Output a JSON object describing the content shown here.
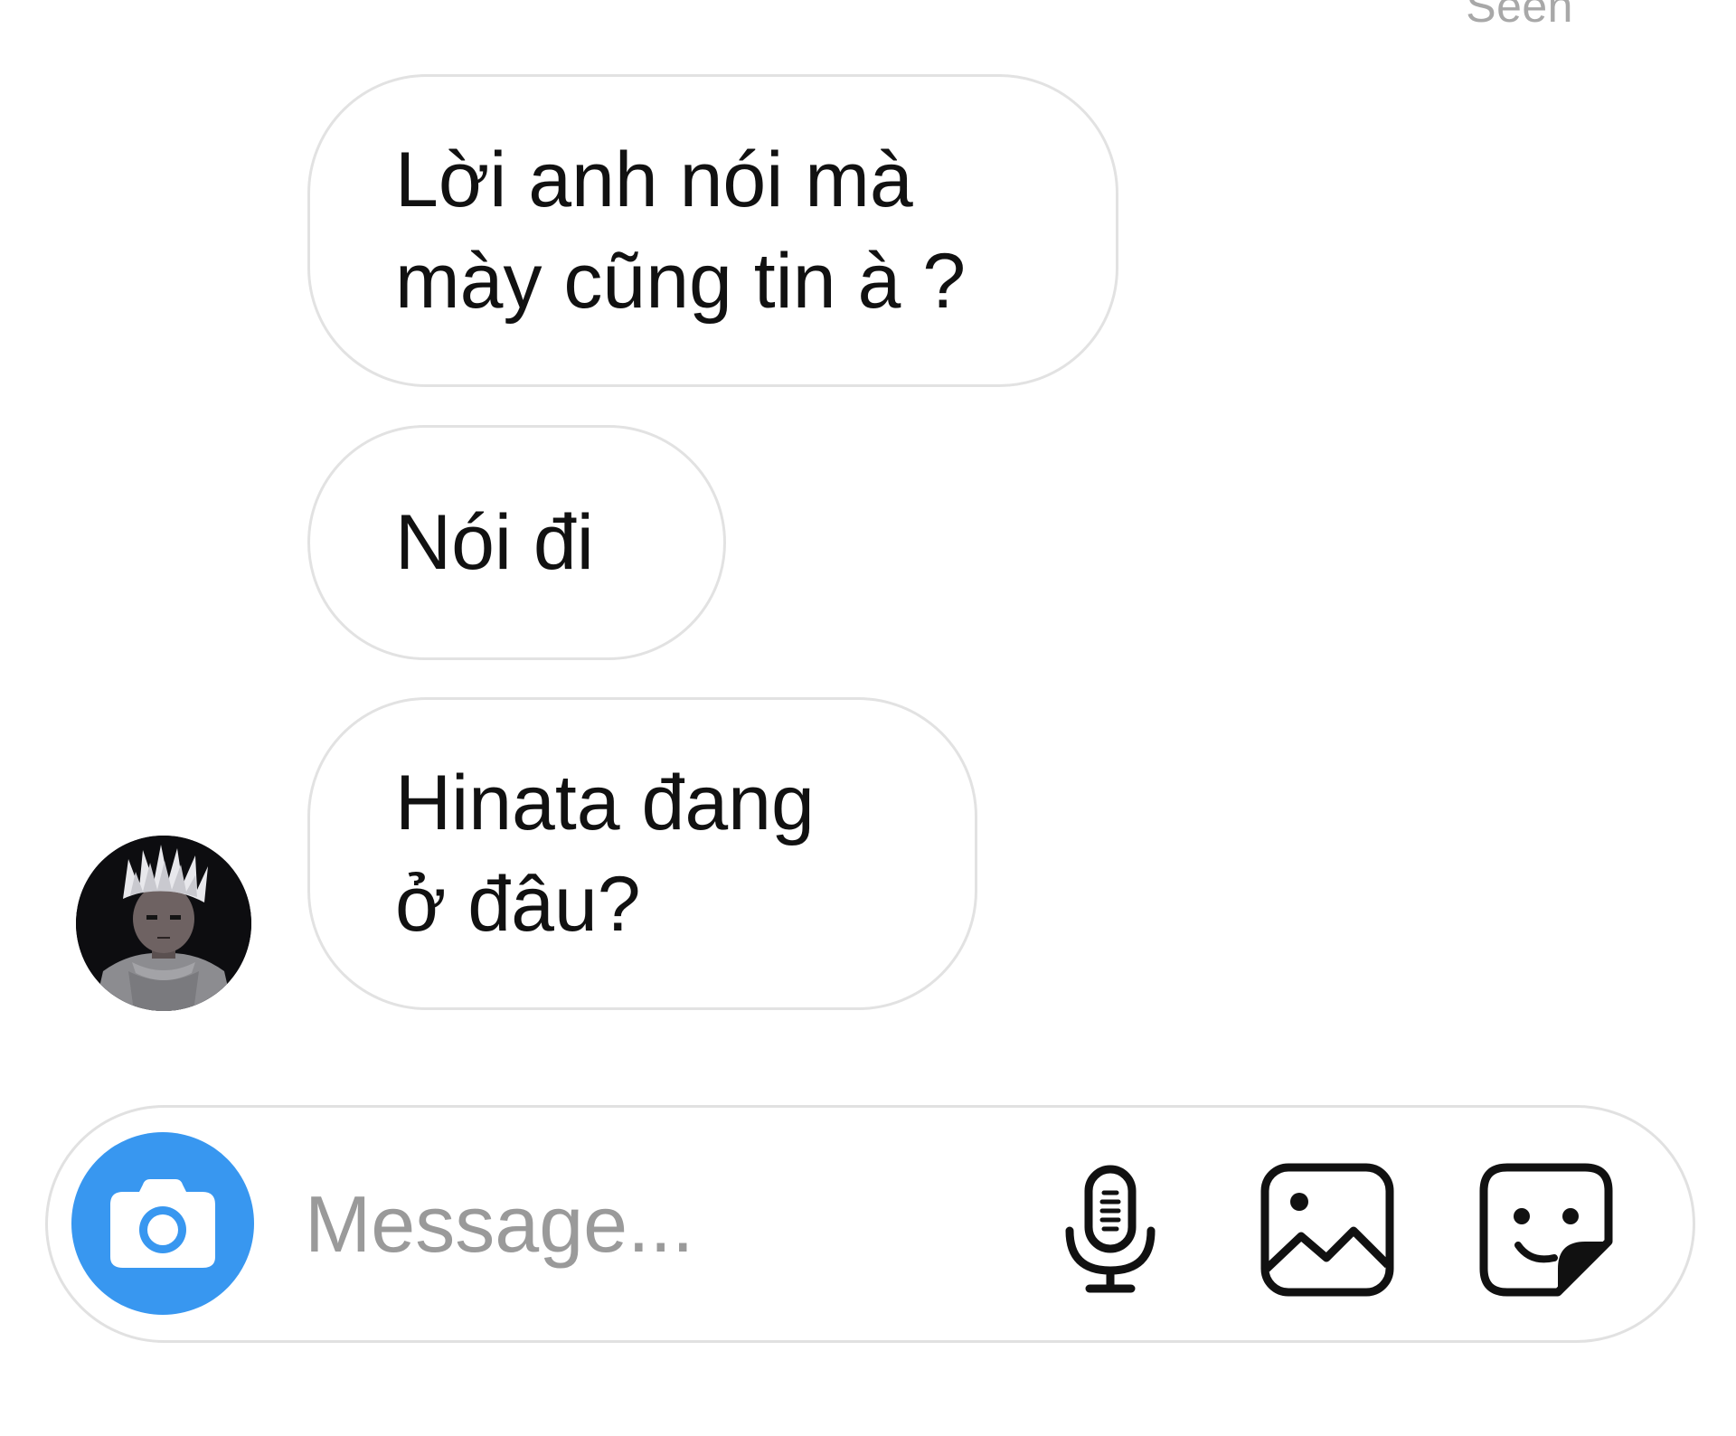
{
  "status": {
    "seen_label": "Seen"
  },
  "messages": [
    {
      "sender": "other",
      "lines": [
        "Lời anh nói mà",
        "mày cũng tin à ?"
      ]
    },
    {
      "sender": "other",
      "lines": [
        "Nói đi"
      ]
    },
    {
      "sender": "other",
      "lines": [
        "Hinata đang",
        "ở đâu?"
      ]
    }
  ],
  "composer": {
    "placeholder": "Message...",
    "value": "",
    "icons": {
      "camera": "camera-icon",
      "mic": "microphone-icon",
      "gallery": "image-gallery-icon",
      "sticker": "sticker-icon"
    }
  },
  "colors": {
    "camera_button": "#3897f0",
    "bubble_border": "#e2e2e2",
    "text": "#111111",
    "placeholder": "#9a9a9a"
  }
}
